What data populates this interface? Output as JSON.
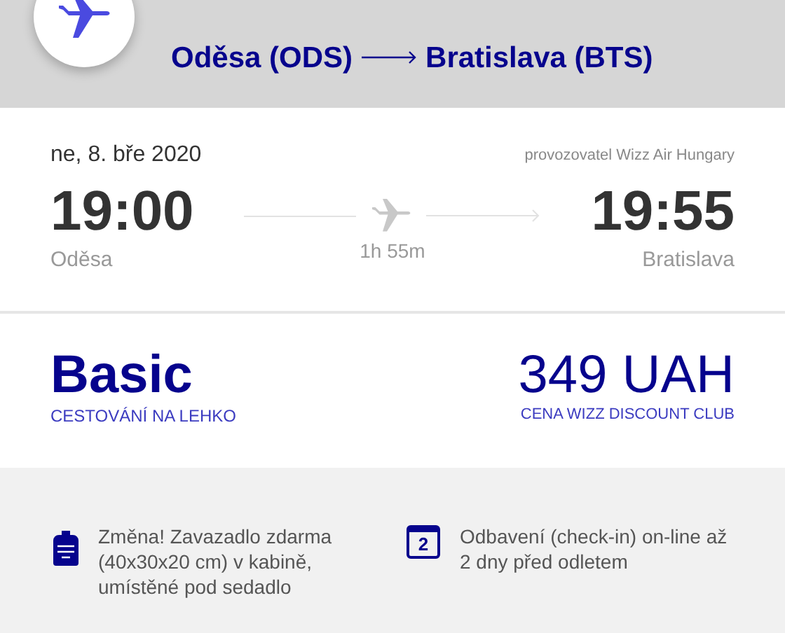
{
  "header": {
    "origin": "Oděsa (ODS)",
    "destination": "Bratislava (BTS)"
  },
  "flight": {
    "date": "ne, 8. bře 2020",
    "operator": "provozovatel Wizz Air Hungary",
    "departure_time": "19:00",
    "departure_city": "Oděsa",
    "duration": "1h 55m",
    "arrival_time": "19:55",
    "arrival_city": "Bratislava"
  },
  "fare": {
    "name": "Basic",
    "subtitle": "CESTOVÁNÍ NA LEHKO",
    "price": "349 UAH",
    "price_note": "CENA WIZZ DISCOUNT CLUB"
  },
  "features": [
    {
      "kind": "bag",
      "text": "Změna! Zavazadlo zdarma (40x30x20 cm) v kabině, umístěné pod sedadlo"
    },
    {
      "kind": "calendar",
      "day": "2",
      "text": "Odbavení (check-in) on-line až 2 dny před odletem"
    }
  ]
}
